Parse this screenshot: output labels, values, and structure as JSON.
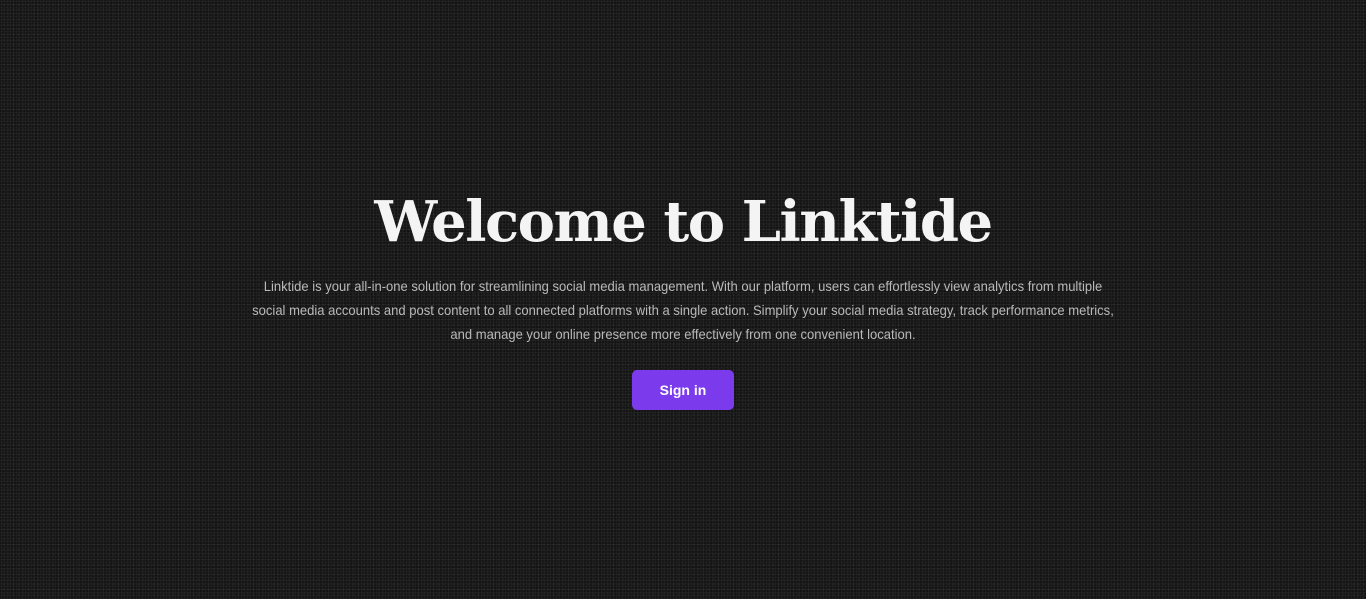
{
  "hero": {
    "title": "Welcome to Linktide",
    "description": "Linktide is your all-in-one solution for streamlining social media management. With our platform, users can effortlessly view analytics from multiple social media accounts and post content to all connected platforms with a single action. Simplify your social media strategy, track performance metrics, and manage your online presence more effectively from one convenient location.",
    "signin_label": "Sign in"
  },
  "colors": {
    "background": "#161616",
    "accent": "#7c3aed",
    "title_text": "#f4f4f4",
    "body_text": "#b9b9b9"
  }
}
